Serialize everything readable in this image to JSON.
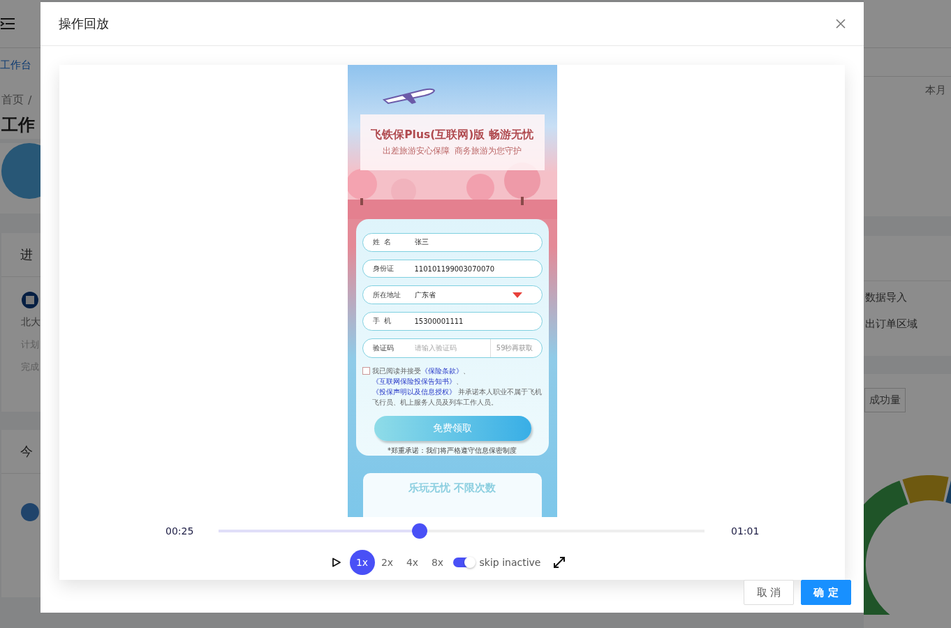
{
  "background": {
    "nav_tab": "工作台",
    "breadcrumb_home": "首页",
    "breadcrumb_sep": "/",
    "page_title": "工作",
    "card_title": "进",
    "project_name": "北大",
    "project_meta": [
      "计划",
      "完成"
    ],
    "card2_title": "今",
    "month_label": "本月",
    "shortcuts": [
      "数据导入",
      "出订单区域"
    ],
    "tab_button": "成功量"
  },
  "dialog": {
    "title": "操作回放",
    "buttons": [
      {
        "label": "取 消",
        "kind": "default"
      },
      {
        "label": "确 定",
        "kind": "primary"
      }
    ]
  },
  "replay_page": {
    "title": "飞铁保Plus(互联网)版 畅游无忧",
    "subtitle": "出差旅游安心保障  商务旅游为您守护",
    "fields": [
      {
        "kind": "text",
        "label": "姓  名",
        "value": "张三"
      },
      {
        "kind": "text",
        "label": "身份证",
        "value": "110101199003070070"
      },
      {
        "kind": "select",
        "label": "所在地址",
        "value": "广东省"
      },
      {
        "kind": "text",
        "label": "手  机",
        "value": "15300001111"
      },
      {
        "kind": "code",
        "label": "验证码",
        "placeholder": "请输入验证码",
        "action": "59秒再获取"
      }
    ],
    "agreement": {
      "checked": false,
      "parts": [
        {
          "text": "我已阅读并接受",
          "kind": "text"
        },
        {
          "text": "《保险条款》",
          "kind": "link"
        },
        {
          "text": "、",
          "kind": "text"
        },
        {
          "text": "《互联网保险投保告知书》",
          "kind": "link"
        },
        {
          "text": "、",
          "kind": "text"
        },
        {
          "text": "《投保声明以及信息授权》",
          "kind": "link"
        },
        {
          "text": " 并承诺本人职业不属于飞机飞行员、机上服务人员及列车工作人员。",
          "kind": "text"
        }
      ]
    },
    "submit": "免费领取",
    "notice": "*郑重承诺：我们将严格遵守信息保密制度",
    "section_title": "乐玩无忧 不限次数"
  },
  "player": {
    "current_time": "00:25",
    "total_time": "01:01",
    "level": 0.414,
    "speeds": [
      {
        "label": "1x",
        "selected": true
      },
      {
        "label": "2x",
        "selected": false
      },
      {
        "label": "4x",
        "selected": false
      },
      {
        "label": "8x",
        "selected": false
      }
    ],
    "skip_inactive": {
      "label": "skip inactive",
      "on": true
    }
  }
}
